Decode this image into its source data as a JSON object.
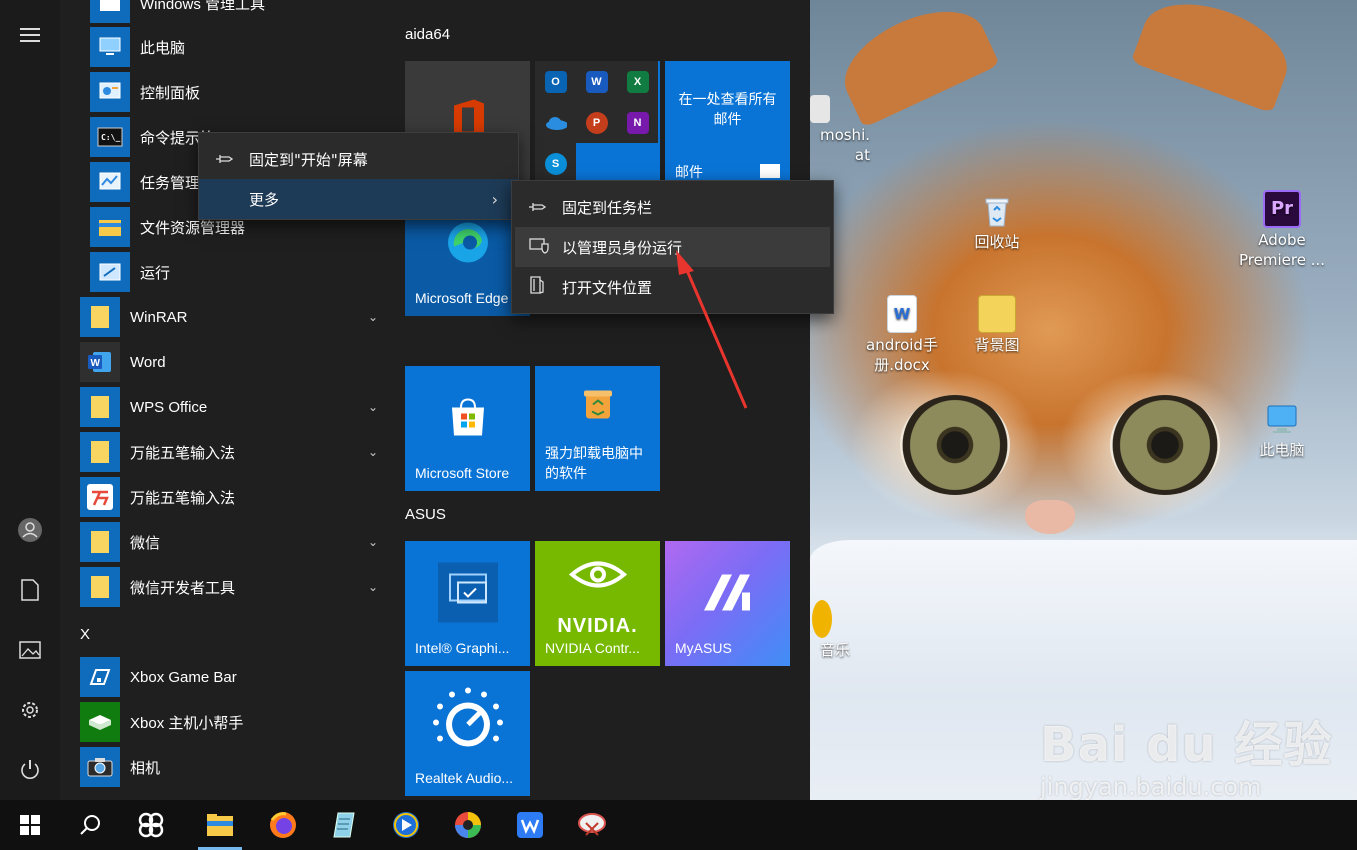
{
  "start_menu": {
    "rail": {
      "menu_icon": "hamburger-icon",
      "user_icon": "user-icon",
      "documents_icon": "document-icon",
      "pictures_icon": "pictures-icon",
      "settings_icon": "gear-icon",
      "power_icon": "power-icon"
    },
    "apps": [
      {
        "label": "Windows 管理工具"
      },
      {
        "label": "此电脑"
      },
      {
        "label": "控制面板"
      },
      {
        "label": "命令提示符"
      },
      {
        "label": "任务管理器"
      },
      {
        "label": "文件资源管理器"
      },
      {
        "label": "运行"
      },
      {
        "label": "WinRAR"
      },
      {
        "label": "Word"
      },
      {
        "label": "WPS Office"
      },
      {
        "label": "万能五笔输入法"
      },
      {
        "label": "万能五笔输入法"
      },
      {
        "label": "微信"
      },
      {
        "label": "微信开发者工具"
      },
      {
        "label": "Xbox Game Bar"
      },
      {
        "label": "Xbox 主机小帮手"
      },
      {
        "label": "相机"
      }
    ],
    "letter_x": "X",
    "groups": {
      "aida64": "aida64",
      "asus": "ASUS"
    },
    "tiles": {
      "mail_text": "在一处查看所有邮件",
      "mail_label": "邮件",
      "edge_label": "Microsoft Edge",
      "store_label": "Microsoft Store",
      "uninstall_label": "强力卸载电脑中的软件",
      "intel_label": "Intel® Graphi...",
      "nvidia_label": "NVIDIA Contr...",
      "nvidia_logo": "NVIDIA.",
      "myasus_label": "MyASUS",
      "realtek_label": "Realtek Audio..."
    }
  },
  "context_menu": {
    "pin_start": "固定到\"开始\"屏幕",
    "more": "更多"
  },
  "submenu": {
    "pin_taskbar": "固定到任务栏",
    "run_as_admin": "以管理员身份运行",
    "open_location": "打开文件位置"
  },
  "desktop": {
    "icons": {
      "partial_top": "moshi.",
      "partial_top2": "at",
      "recycle_bin": "回收站",
      "premiere": "Adobe Premiere ...",
      "android_doc": "android手册.docx",
      "wallpaper_folder": "背景图",
      "this_pc": "此电脑",
      "music_partial": "音乐"
    },
    "watermark_logo": "Bai du 经验",
    "watermark_url": "jingyan.baidu.com"
  },
  "taskbar": {
    "start_icon": "windows-start-icon",
    "search_icon": "search-icon",
    "apps": [
      "pinwheel-icon",
      "file-explorer-icon",
      "firefox-icon",
      "notepad-icon",
      "media-player-icon",
      "color-wheel-icon",
      "wps-writer-icon",
      "snipping-tool-icon"
    ]
  },
  "colors": {
    "tile_blue": "#0a74d6",
    "nvidia_green": "#76b900",
    "menu_bg": "#2b2b2b",
    "annotation_red": "#e8352e"
  }
}
